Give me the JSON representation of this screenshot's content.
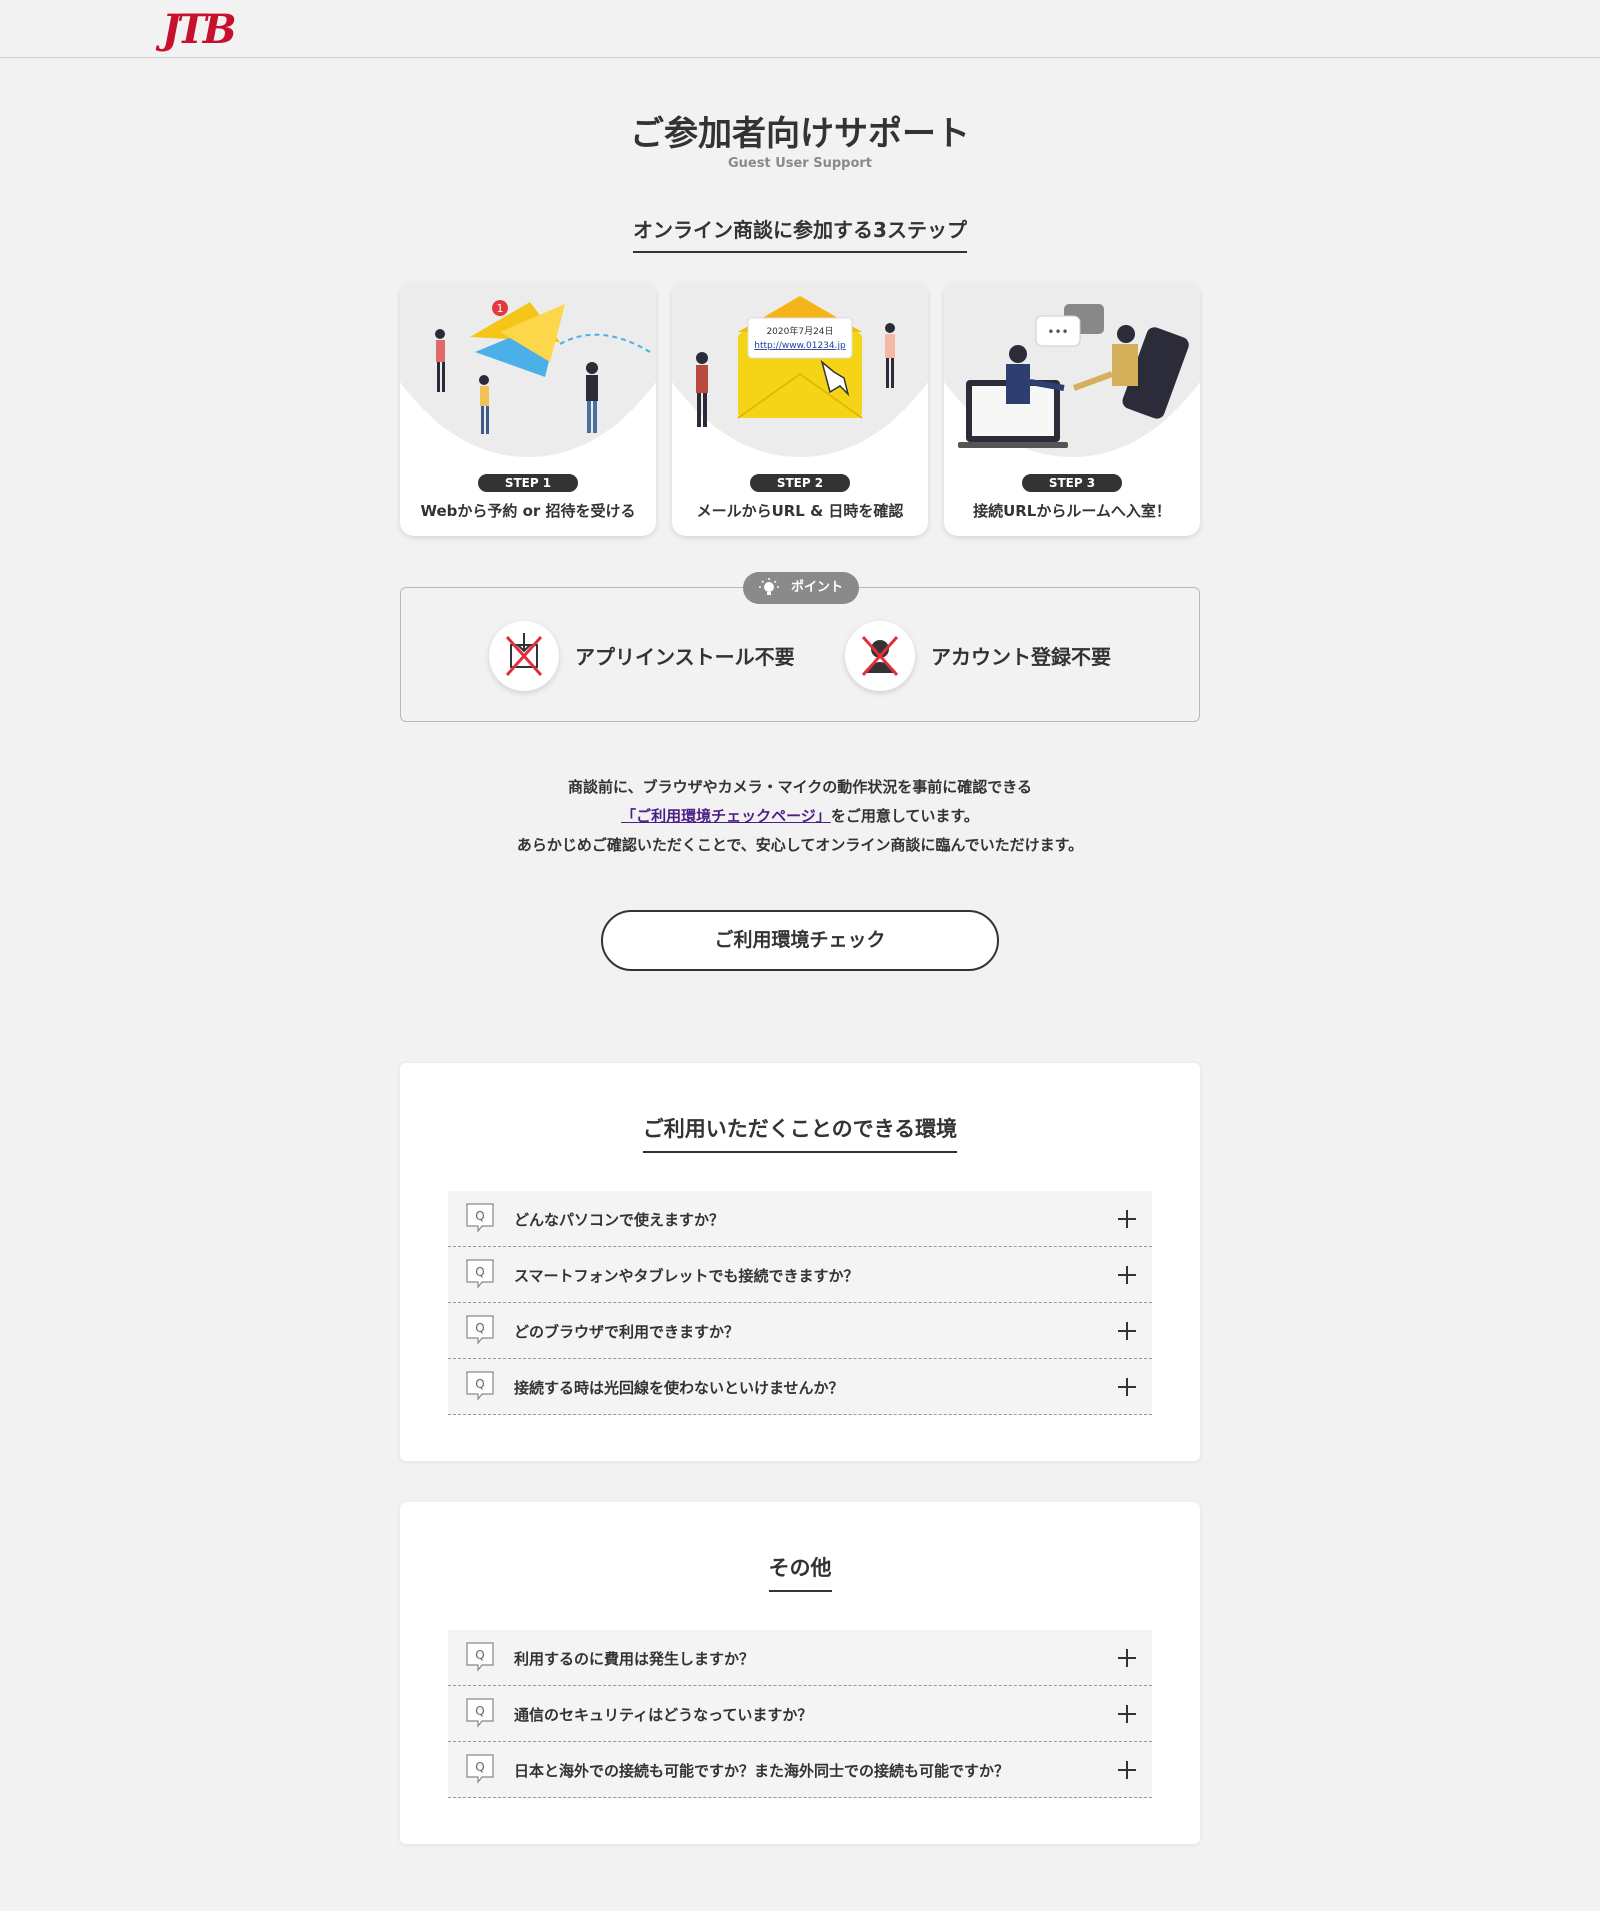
{
  "header": {
    "logo_text": "JTB"
  },
  "page": {
    "title": "ご参加者向けサポート",
    "subtitle": "Guest User Support"
  },
  "steps_section": {
    "heading": "オンライン商談に参加する3ステップ",
    "steps": [
      {
        "badge": "STEP 1",
        "label": "Webから予約 or 招待を受ける",
        "notification_count": "1"
      },
      {
        "badge": "STEP 2",
        "label": "メールからURL & 日時を確認",
        "mail_date": "2020年7月24日",
        "mail_url": "http://www.01234.jp"
      },
      {
        "badge": "STEP 3",
        "label": "接続URLからルームへ入室！",
        "chat_text": "•••"
      }
    ]
  },
  "point": {
    "tag": "ポイント",
    "items": [
      {
        "label": "アプリインストール不要",
        "icon": "no-install-icon"
      },
      {
        "label": "アカウント登録不要",
        "icon": "no-account-icon"
      }
    ]
  },
  "description": {
    "line1": "商談前に、ブラウザやカメラ・マイクの動作状況を事前に確認できる",
    "link": "「ご利用環境チェックページ」",
    "line2_suffix": "をご用意しています。",
    "line3": "あらかじめご確認いただくことで、安心してオンライン商談に臨んでいただけます。"
  },
  "check_button": {
    "label": "ご利用環境チェック"
  },
  "env_section": {
    "heading": "ご利用いただくことのできる環境",
    "faqs": [
      "どんなパソコンで使えますか？",
      "スマートフォンやタブレットでも接続できますか？",
      "どのブラウザで利用できますか？",
      "接続する時は光回線を使わないといけませんか？"
    ]
  },
  "other_section": {
    "heading": "その他",
    "faqs": [
      "利用するのに費用は発生しますか？",
      "通信のセキュリティはどうなっていますか？",
      "日本と海外での接続も可能ですか？また海外同士での接続も可能ですか？"
    ]
  },
  "colors": {
    "brand": "#c8102e",
    "link": "#4b1f86",
    "background": "#f2f2f2",
    "text": "#333333"
  }
}
